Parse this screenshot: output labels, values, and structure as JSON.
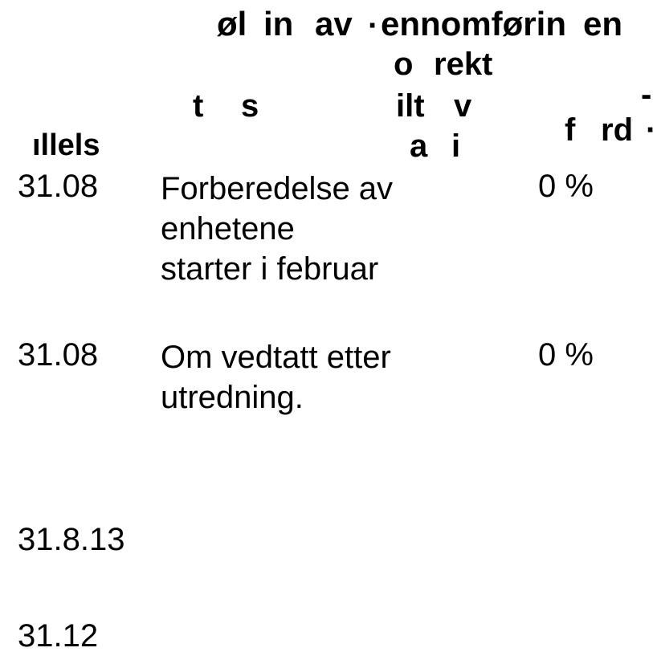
{
  "header": {
    "line1a": "øl",
    "line1b": "in",
    "line1c": "av",
    "line1d": "ennomførin",
    "line1e": "en",
    "line2a": "o",
    "line2b": "rekt",
    "line3a": "t",
    "line3b": "s",
    "line3c": "ilt",
    "line3d": "v",
    "line3e": "f",
    "line3f": "rd",
    "line4a": "ıllels",
    "line4b": "a",
    "line4c": "i"
  },
  "rows": [
    {
      "date": "31.08",
      "text": "Forberedelse av enhetene starter i februar",
      "pct": "0 %"
    },
    {
      "date": "31.08",
      "text": "Om vedtatt etter utredning.",
      "pct": "0 %"
    },
    {
      "date": "31.8.13",
      "text": "",
      "pct": ""
    },
    {
      "date": "31.12",
      "text": "",
      "pct": ""
    }
  ]
}
